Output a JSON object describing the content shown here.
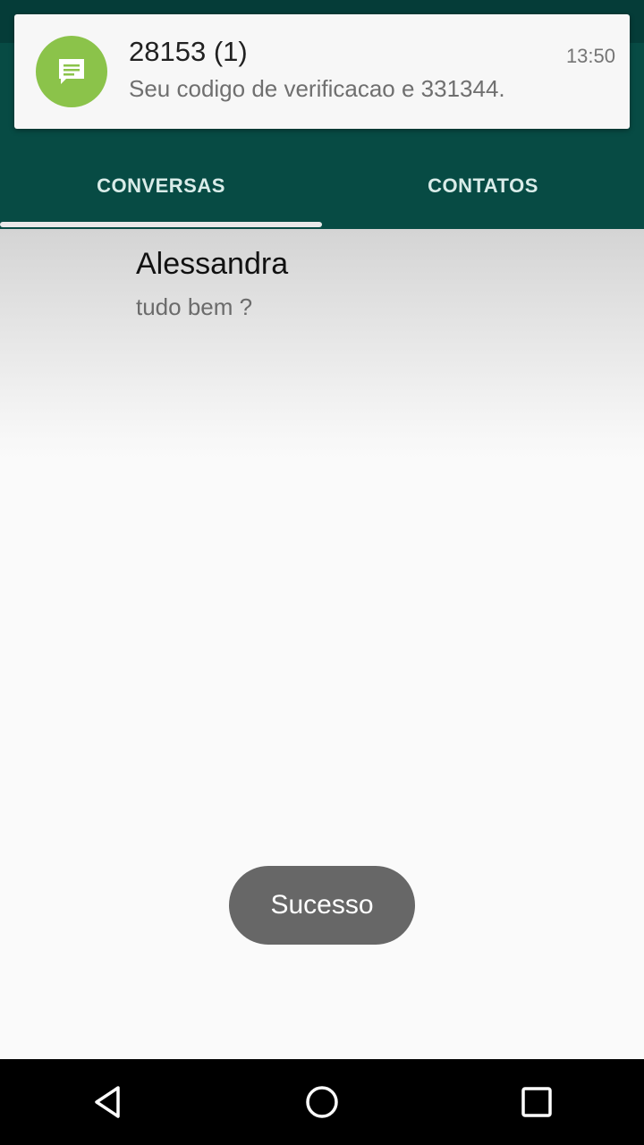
{
  "notification": {
    "title": "28153 (1)",
    "text": "Seu codigo de verificacao e 331344.",
    "time": "13:50",
    "icon": "message-icon",
    "icon_color": "#8bc34a"
  },
  "tabs": [
    {
      "label": "CONVERSAS",
      "selected": true
    },
    {
      "label": "CONTATOS",
      "selected": false
    }
  ],
  "conversations": [
    {
      "name": "Alessandra",
      "last_message": "tudo bem ?"
    }
  ],
  "toast": {
    "text": "Sucesso"
  },
  "nav": {
    "back_icon": "back-icon",
    "home_icon": "home-icon",
    "recents_icon": "recents-icon"
  },
  "colors": {
    "app_bar": "#074b44",
    "status_bar": "#053c38",
    "background": "#fafafa"
  }
}
